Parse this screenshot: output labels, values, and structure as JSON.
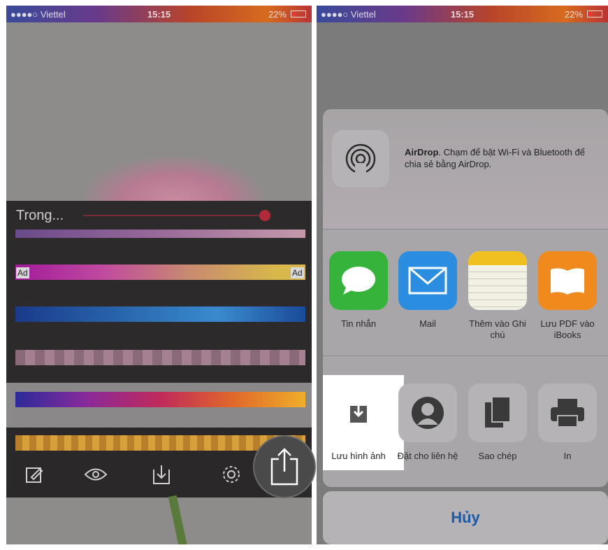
{
  "left_screen": {
    "status": {
      "carrier": "●●●●○ Viettel",
      "time": "15:15",
      "battery": "22%"
    },
    "edit_label": "Trong...",
    "ad_left": "Ad",
    "ad_right": "Ad",
    "toolbar": [
      "pencil-icon",
      "eye-icon",
      "download-icon",
      "gear-icon",
      "share-icon"
    ]
  },
  "right_screen": {
    "status": {
      "carrier": "●●●●○ Viettel",
      "time": "15:15",
      "battery": "22%"
    },
    "airdrop": {
      "title": "AirDrop",
      "text": ". Chạm để bật Wi-Fi và Bluetooth để chia sẻ bằng AirDrop."
    },
    "apps": [
      {
        "label": "Tin nhắn",
        "icon": "messages-icon",
        "color": "#35b33a"
      },
      {
        "label": "Mail",
        "icon": "mail-icon",
        "color": "#2a8de0"
      },
      {
        "label": "Thêm vào Ghi chú",
        "icon": "notes-icon",
        "color": "#f3f1e6"
      },
      {
        "label": "Lưu PDF vào iBooks",
        "icon": "ibooks-icon",
        "color": "#f08a1c"
      }
    ],
    "actions": [
      {
        "label": "Lưu hình ảnh",
        "icon": "save-image-icon"
      },
      {
        "label": "Đặt cho liên hệ",
        "icon": "contact-icon"
      },
      {
        "label": "Sao chép",
        "icon": "copy-icon"
      },
      {
        "label": "In",
        "icon": "print-icon"
      }
    ],
    "cancel_label": "Hủy"
  }
}
